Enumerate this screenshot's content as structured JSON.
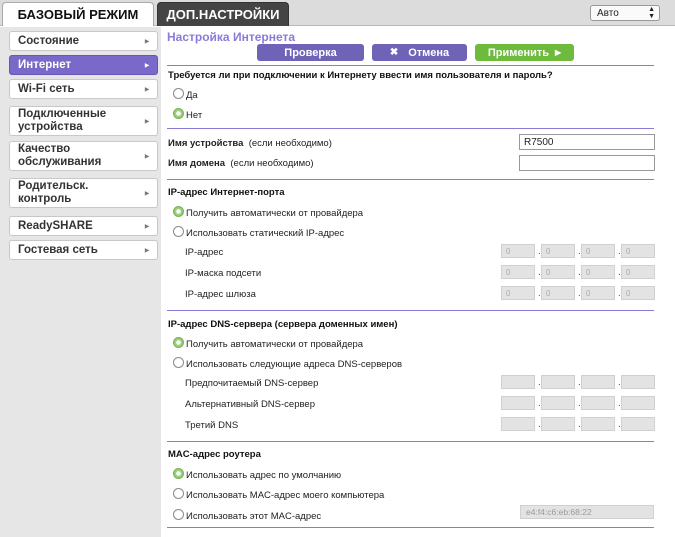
{
  "tabs": {
    "basic": "БАЗОВЫЙ РЕЖИМ",
    "advanced": "ДОП.НАСТРОЙКИ"
  },
  "language": {
    "value": "Авто"
  },
  "sidebar": {
    "items": [
      {
        "label": "Состояние"
      },
      {
        "label": "Интернет",
        "active": true
      },
      {
        "label": "Wi-Fi сеть"
      },
      {
        "label": "Подключенные устройства"
      },
      {
        "label": "Качество обслуживания"
      },
      {
        "label": "Родительск. контроль"
      },
      {
        "label": "ReadySHARE"
      },
      {
        "label": "Гостевая сеть"
      }
    ]
  },
  "page": {
    "title": "Настройка Интернета"
  },
  "buttons": {
    "check": "Проверка",
    "cancel": "Отмена",
    "apply": "Применить"
  },
  "login_question": {
    "text": "Требуется ли при подключении к Интернету ввести имя пользователя и пароль?",
    "options": [
      "Да",
      "Нет"
    ],
    "selected": "Нет"
  },
  "device": {
    "name_label": "Имя устройства",
    "name_hint": "(если необходимо)",
    "name_value": "R7500",
    "domain_label": "Имя домена",
    "domain_hint": "(если необходимо)",
    "domain_value": ""
  },
  "ip_section": {
    "title": "IP-адрес Интернет-порта",
    "options": [
      "Получить автоматически от провайдера",
      "Использовать статический IP-адрес"
    ],
    "selected": "Получить автоматически от провайдера",
    "fields": [
      {
        "label": "IP-адрес",
        "octets": [
          "0",
          "0",
          "0",
          "0"
        ]
      },
      {
        "label": "IP-маска подсети",
        "octets": [
          "0",
          "0",
          "0",
          "0"
        ]
      },
      {
        "label": "IP-адрес шлюза",
        "octets": [
          "0",
          "0",
          "0",
          "0"
        ]
      }
    ]
  },
  "dns_section": {
    "title": "IP-адрес DNS-сервера (сервера доменных имен)",
    "options": [
      "Получить автоматически от провайдера",
      "Использовать следующие адреса DNS-серверов"
    ],
    "selected": "Получить автоматически от провайдера",
    "fields": [
      {
        "label": "Предпочитаемый DNS-сервер"
      },
      {
        "label": "Альтернативный DNS-сервер"
      },
      {
        "label": "Третий DNS"
      }
    ]
  },
  "mac_section": {
    "title": "MAC-адрес роутера",
    "options": [
      "Использовать адрес по умолчанию",
      "Использовать MAC-адрес моего компьютера",
      "Использовать этот MAC-адрес"
    ],
    "selected": "Использовать адрес по умолчанию",
    "mac_value": "e4:f4:c6:eb:68:22"
  },
  "colors": {
    "accent": "#7a69c9",
    "apply": "#6dba3d",
    "radio_on": "#7ab55c"
  }
}
